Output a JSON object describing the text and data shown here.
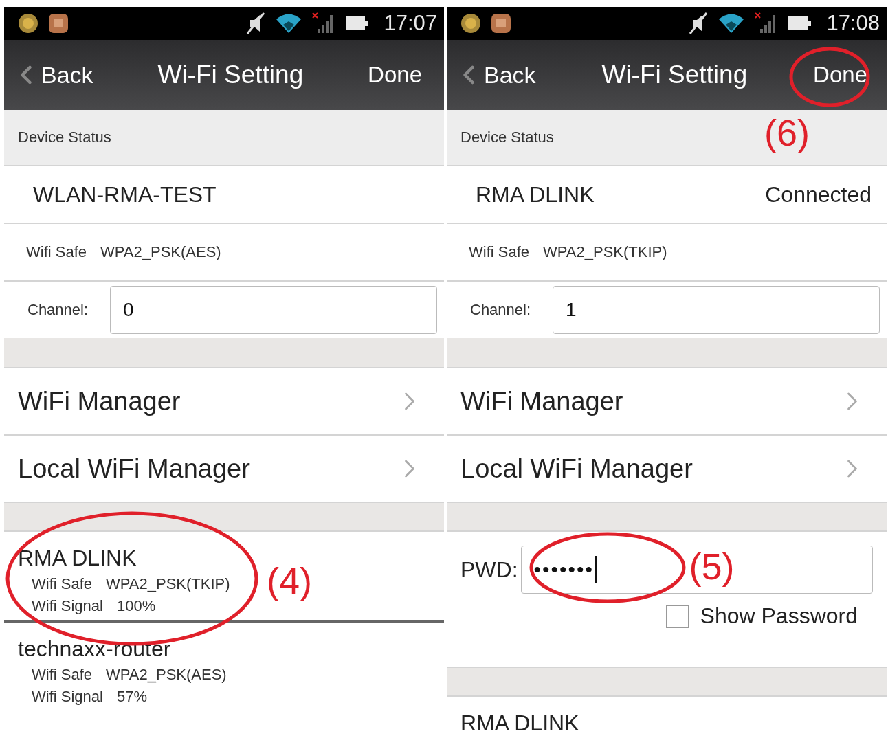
{
  "screens": [
    {
      "status_bar": {
        "time": "17:07"
      },
      "nav": {
        "back": "Back",
        "title": "Wi-Fi Setting",
        "done": "Done"
      },
      "section_header": "Device Status",
      "device": {
        "name": "WLAN-RMA-TEST"
      },
      "wifi_safe": {
        "label": "Wifi Safe",
        "value": "WPA2_PSK(AES)"
      },
      "channel": {
        "label": "Channel:",
        "value": "0"
      },
      "menu": [
        {
          "label": "WiFi Manager"
        },
        {
          "label": "Local WiFi Manager"
        }
      ],
      "networks": [
        {
          "name": "RMA DLINK",
          "safe_label": "Wifi Safe",
          "safe": "WPA2_PSK(TKIP)",
          "signal_label": "Wifi Signal",
          "signal": "100%",
          "callout": "(4)"
        },
        {
          "name": "technaxx-router",
          "safe_label": "Wifi Safe",
          "safe": "WPA2_PSK(AES)",
          "signal_label": "Wifi Signal",
          "signal": "57%"
        }
      ]
    },
    {
      "status_bar": {
        "time": "17:08"
      },
      "nav": {
        "back": "Back",
        "title": "Wi-Fi Setting",
        "done": "Done",
        "done_callout": "(6)"
      },
      "section_header": "Device Status",
      "device": {
        "name": "RMA DLINK",
        "status": "Connected"
      },
      "wifi_safe": {
        "label": "Wifi Safe",
        "value": "WPA2_PSK(TKIP)"
      },
      "channel": {
        "label": "Channel:",
        "value": "1"
      },
      "menu": [
        {
          "label": "WiFi Manager"
        },
        {
          "label": "Local WiFi Manager"
        }
      ],
      "password": {
        "label": "PWD:",
        "value": "•••••••",
        "callout": "(5)",
        "show_label": "Show Password",
        "show_checked": false
      },
      "networks": [
        {
          "name": "RMA DLINK"
        }
      ]
    }
  ]
}
